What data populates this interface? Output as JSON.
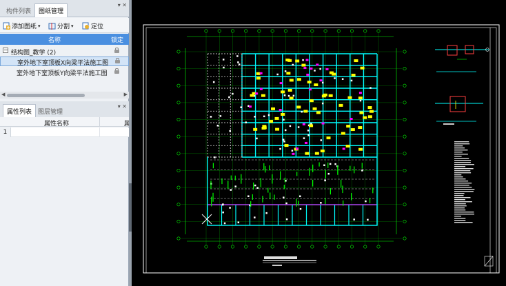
{
  "top_panel": {
    "tabs": [
      "构件列表",
      "图纸管理"
    ],
    "active_tab": 1,
    "pin_icon": "pin-icon",
    "toolbar": {
      "add_drawing_label": "添加图纸",
      "split_label": "分割",
      "locate_label": "定位"
    },
    "columns": {
      "name": "名称",
      "lock": "锁定"
    },
    "tree": {
      "group_label": "结构图_教学 (2)",
      "items": [
        {
          "label": "室外地下室顶板X向梁平法施工图",
          "selected": true
        },
        {
          "label": "室外地下室顶板Y向梁平法施工图",
          "selected": false
        }
      ]
    }
  },
  "bottom_panel": {
    "tabs": [
      "属性列表",
      "图层管理"
    ],
    "active_tab": 0,
    "columns": {
      "property_name": "属性名称",
      "value": "属"
    },
    "rows": [
      "1"
    ]
  },
  "canvas": {
    "background": "#000000",
    "line_color": "#00ff00",
    "beam_color": "#00ffff",
    "tag_color": "#ffff00",
    "accent_color": "#ff00ff"
  }
}
